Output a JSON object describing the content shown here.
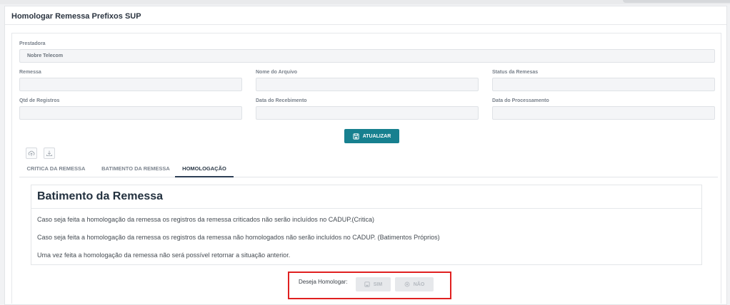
{
  "page": {
    "title": "Homologar Remessa Prefixos SUP"
  },
  "form": {
    "prestadora_label": "Prestadora",
    "prestadora_value": "Nobre Telecom",
    "remessa_label": "Remessa",
    "remessa_value": "",
    "nome_arquivo_label": "Nome do Arquivo",
    "nome_arquivo_value": "",
    "status_label": "Status da Remesas",
    "status_value": "",
    "qtd_registros_label": "Qtd de Registros",
    "qtd_registros_value": "",
    "data_recebimento_label": "Data do Recebimento",
    "data_recebimento_value": "",
    "data_processamento_label": "Data do Processamento",
    "data_processamento_value": "",
    "atualizar_label": "ATUALIZAR"
  },
  "tabs": [
    {
      "label": "CRITICA DA REMESSA",
      "active": false
    },
    {
      "label": "BATIMENTO DA REMESSA",
      "active": false
    },
    {
      "label": "HOMOLOGAÇÃO",
      "active": true
    }
  ],
  "panel": {
    "title": "Batimento da Remessa",
    "lines": [
      "Caso seja feita a homologação da remessa os registros da remessa criticados não serão incluídos no CADUP.(Critica)",
      "Caso seja feita a homologação da remessa os registros da remessa não homologados não serão incluídos no CADUP. (Batimentos Próprios)",
      "Uma vez feita a homologação da remessa não será possível retornar a situação anterior."
    ]
  },
  "confirm": {
    "label": "Deseja Homologar:",
    "sim_label": "SIM",
    "nao_label": "NÃO"
  },
  "colors": {
    "accent": "#17808f",
    "highlight_border": "#e02020",
    "active_tab": "#2d3f55"
  },
  "icons": [
    "save-icon",
    "upload-cloud-icon",
    "download-icon",
    "save-icon",
    "close-circle-icon"
  ]
}
